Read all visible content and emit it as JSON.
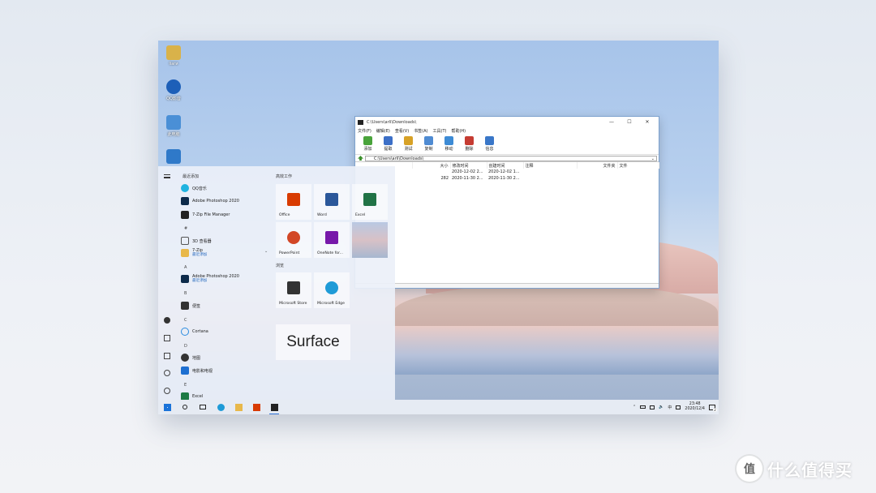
{
  "desktop": {
    "icons": [
      {
        "name": "user-folder",
        "label": "liarи",
        "color": "#d9b24a"
      },
      {
        "name": "qq-video",
        "label": "QQ影音",
        "color": "#1d5fb8"
      },
      {
        "name": "this-pc",
        "label": "此电脑",
        "color": "#4a8fd6"
      },
      {
        "name": "network",
        "label": "",
        "color": "#2f79c9"
      }
    ]
  },
  "zip_window": {
    "title": "C:\\Users\\arli\\Downloads\\",
    "window_buttons": {
      "minimize": "—",
      "maximize": "☐",
      "close": "✕"
    },
    "menu": [
      "文件(F)",
      "编辑(E)",
      "查看(V)",
      "书签(A)",
      "工具(T)",
      "帮助(H)"
    ],
    "toolbar": [
      {
        "label": "添加",
        "color": "#49a33b"
      },
      {
        "label": "提取",
        "color": "#3c6fc7"
      },
      {
        "label": "测试",
        "color": "#d7a126"
      },
      {
        "label": "复制",
        "color": "#4f8bd2"
      },
      {
        "label": "移动",
        "color": "#3d8bd5"
      },
      {
        "label": "删除",
        "color": "#c53c32"
      },
      {
        "label": "信息",
        "color": "#3a77c8"
      }
    ],
    "address": "C:\\Users\\arli\\Downloads\\",
    "columns": [
      "",
      "大小",
      "修改时间",
      "创建时间",
      "注释",
      "文件夹",
      "文件"
    ],
    "rows": [
      [
        "",
        "",
        "2020-12-02 2...",
        "2020-12-02 1...",
        "",
        "",
        ""
      ],
      [
        "",
        "282",
        "2020-11-30 2...",
        "2020-11-30 2...",
        "",
        "",
        ""
      ]
    ]
  },
  "start_menu": {
    "recent_header": "最近添加",
    "apps": [
      {
        "id": "qq-music",
        "label": "QQ音乐",
        "sub": "",
        "color": "#1fb3e0"
      },
      {
        "id": "photoshop-recent",
        "label": "Adobe Photoshop 2020",
        "sub": "",
        "color": "#0c2a4a"
      },
      {
        "id": "7zip-recent",
        "label": "7-Zip File Manager",
        "sub": "",
        "color": "#222222"
      },
      {
        "id": "3d-viewer",
        "label": "3D 查看器",
        "sub": "",
        "color": "#555555"
      },
      {
        "id": "7zip-folder",
        "label": "7-Zip",
        "sub": "最近添加",
        "color": "#e8b84a"
      },
      {
        "id": "photoshop",
        "label": "Adobe Photoshop 2020",
        "sub": "最近添加",
        "color": "#0c2a4a"
      },
      {
        "id": "sticky",
        "label": "便签",
        "sub": "",
        "color": "#333333"
      },
      {
        "id": "cortana",
        "label": "Cortana",
        "sub": "",
        "color": "#2a8be0"
      },
      {
        "id": "maps",
        "label": "地图",
        "sub": "",
        "color": "#333333"
      },
      {
        "id": "movies",
        "label": "电影和电视",
        "sub": "",
        "color": "#1d6fd1"
      },
      {
        "id": "excel-list",
        "label": "Excel",
        "sub": "",
        "color": "#1d7a44"
      }
    ],
    "letters": {
      "hash": "#",
      "a": "A",
      "b": "B",
      "c": "C",
      "d": "D",
      "e": "E"
    },
    "group_work": "高效工作",
    "group_browse": "浏览",
    "tiles": [
      {
        "id": "office",
        "label": "Office",
        "color": "#d83b01"
      },
      {
        "id": "word",
        "label": "Word",
        "color": "#2b579a"
      },
      {
        "id": "excel",
        "label": "Excel",
        "color": "#217346"
      },
      {
        "id": "powerpoint",
        "label": "PowerPoint",
        "color": "#d24726"
      },
      {
        "id": "onenote",
        "label": "OneNote for...",
        "color": "#7719aa"
      },
      {
        "id": "photos",
        "label": "",
        "color": "#c9b4bf"
      },
      {
        "id": "ms-store",
        "label": "Microsoft Store",
        "color": "#333333"
      },
      {
        "id": "ms-edge",
        "label": "Microsoft Edge",
        "color": "#1f9bd7"
      }
    ],
    "surface_tile": "Surface"
  },
  "taskbar": {
    "time": "23:48",
    "date": "2020/12/4",
    "ime": "中",
    "notification_count": "2"
  },
  "watermark": {
    "logo_glyph": "值",
    "text": "什么值得买"
  }
}
